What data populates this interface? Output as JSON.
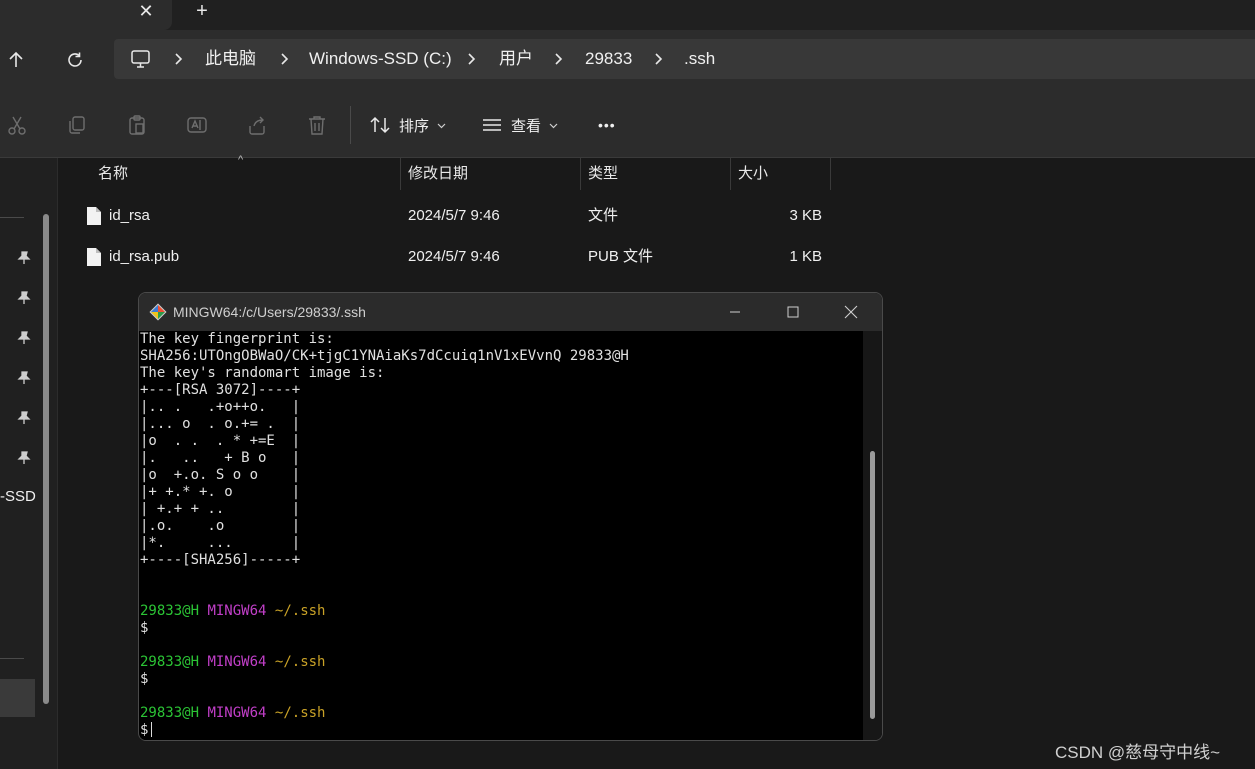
{
  "tabstrip": {
    "close_symbol": "✕",
    "new_symbol": "+"
  },
  "breadcrumb": [
    "此电脑",
    "Windows-SSD (C:)",
    "用户",
    "29833",
    ".ssh"
  ],
  "toolbar": {
    "sort_label": "排序",
    "view_label": "查看",
    "more_label": "•••"
  },
  "columns": {
    "name": "名称",
    "modified": "修改日期",
    "type": "类型",
    "size": "大小"
  },
  "files": [
    {
      "name": "id_rsa",
      "modified": "2024/5/7 9:46",
      "type": "文件",
      "size": "3 KB"
    },
    {
      "name": "id_rsa.pub",
      "modified": "2024/5/7 9:46",
      "type": "PUB 文件",
      "size": "1 KB"
    }
  ],
  "navpane": {
    "drive_fragment": "-SSD"
  },
  "terminal": {
    "title": "MINGW64:/c/Users/29833/.ssh",
    "lines": [
      "The key fingerprint is:",
      "SHA256:UTOngOBWaO/CK+tjgC1YNAiaKs7dCcuiq1nV1xEVvnQ 29833@H",
      "The key's randomart image is:",
      "+---[RSA 3072]----+",
      "|.. .   .+o++o.   |",
      "|... o  . o.+= .  |",
      "|o  . .  . * +=E  |",
      "|.   ..   + B o   |",
      "|o  +.o. S o o    |",
      "|+ +.* +. o       |",
      "| +.+ + ..        |",
      "|.o.    .o        |",
      "|*.     ...       |",
      "+----[SHA256]-----+"
    ],
    "prompts": [
      {
        "user": "29833@H",
        "env": "MINGW64",
        "path": "~/.ssh",
        "symbol": "$"
      },
      {
        "user": "29833@H",
        "env": "MINGW64",
        "path": "~/.ssh",
        "symbol": "$"
      },
      {
        "user": "29833@H",
        "env": "MINGW64",
        "path": "~/.ssh",
        "symbol": "$"
      }
    ]
  },
  "watermark": "CSDN @慈母守中线~",
  "colors": {
    "prompt_user": "#2bc435",
    "prompt_env": "#c23fc9",
    "prompt_path": "#c9a227"
  }
}
